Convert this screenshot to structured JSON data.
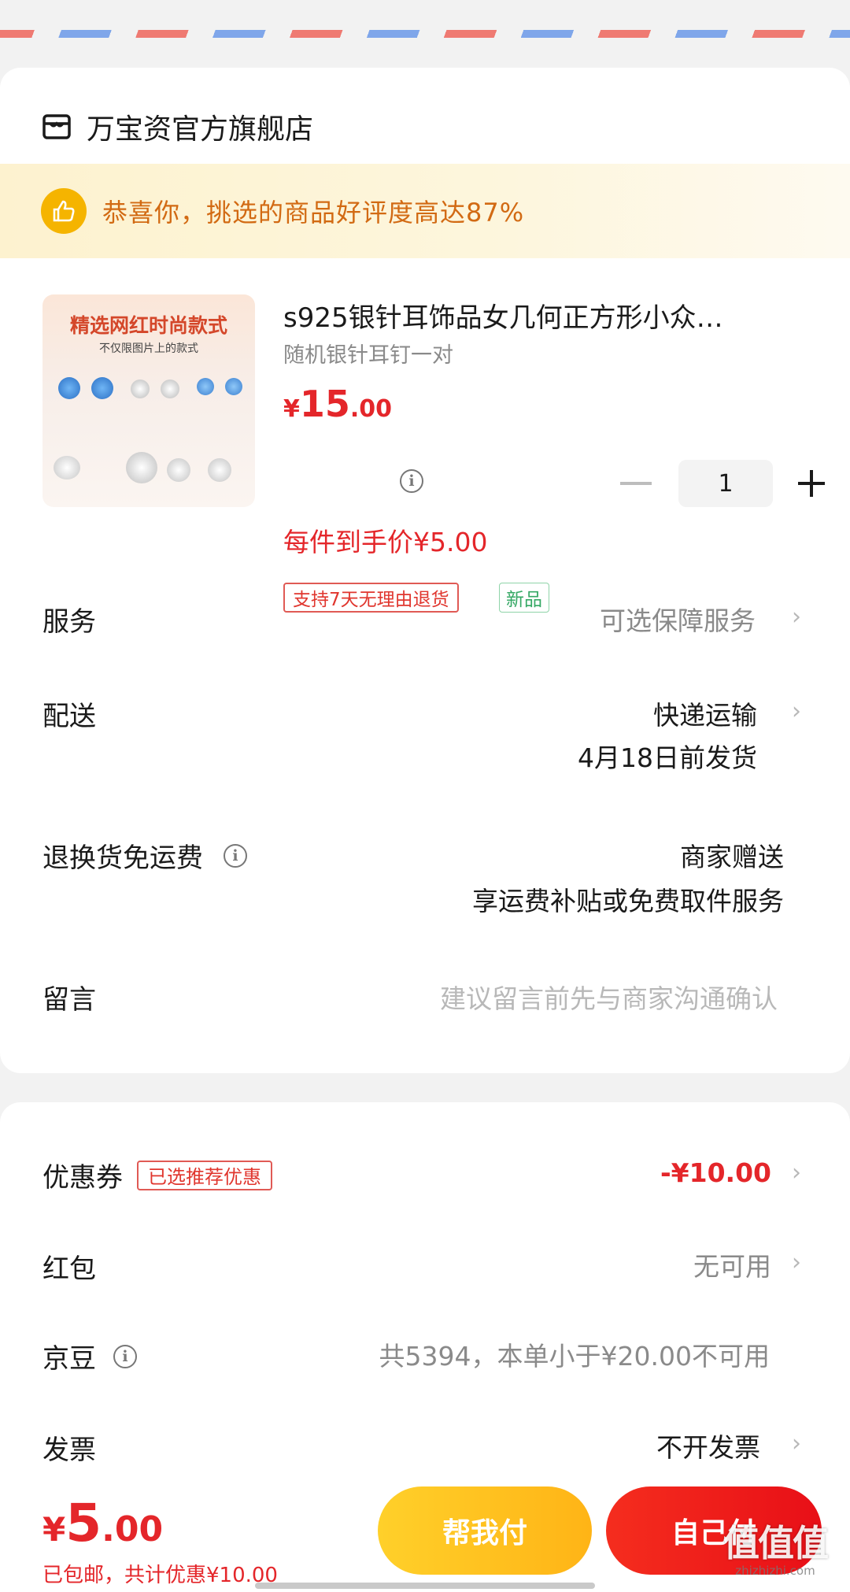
{
  "store": {
    "name": "万宝资官方旗舰店",
    "icon": "store-icon"
  },
  "banner": {
    "text": "恭喜你，挑选的商品好评度高达87%",
    "icon": "thumbs-up-icon"
  },
  "product": {
    "image_title": "精选网红时尚款式",
    "image_subtitle": "不仅限图片上的款式",
    "title": "s925银针耳饰品女几何正方形小众…",
    "spec": "随机银针耳钉一对",
    "price_currency": "¥",
    "price_integer": "15",
    "price_decimal": ".00",
    "unit_price": "每件到手价¥5.00",
    "quantity": "1",
    "tag_return": "支持7天无理由退货",
    "tag_new": "新品"
  },
  "rows": {
    "service": {
      "label": "服务",
      "value": "可选保障服务"
    },
    "delivery": {
      "label": "配送",
      "value": "快递运输",
      "value2": "4月18日前发货"
    },
    "freight": {
      "label": "退换货免运费",
      "value": "商家赠送",
      "value2": "享运费补贴或免费取件服务"
    },
    "message": {
      "label": "留言",
      "placeholder": "建议留言前先与商家沟通确认"
    }
  },
  "discounts": {
    "coupon": {
      "label": "优惠券",
      "tag": "已选推荐优惠",
      "value": "-¥10.00"
    },
    "red_packet": {
      "label": "红包",
      "value": "无可用"
    },
    "jd_beans": {
      "label": "京豆",
      "value": "共5394，本单小于¥20.00不可用"
    },
    "invoice": {
      "label": "发票",
      "value": "不开发票"
    }
  },
  "bottom": {
    "currency": "¥",
    "total_integer": "5",
    "total_decimal": ".00",
    "summary": "已包邮，共计优惠¥10.00",
    "help_pay_label": "帮我付",
    "self_pay_label": "自己付"
  },
  "watermark": {
    "main": "值值值",
    "sub": "zhizhizhi.com"
  },
  "colors": {
    "price_red": "#e4262a",
    "accent_orange": "#d26a13",
    "help_btn": "#ffc21f",
    "pay_btn": "#ee1c1a"
  }
}
